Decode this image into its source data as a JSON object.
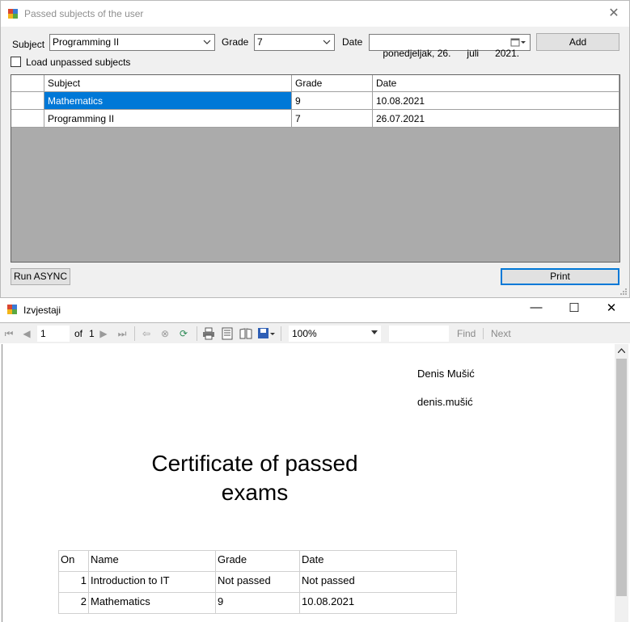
{
  "window1": {
    "title": "Passed subjects of the user",
    "subject_label": "Subject",
    "subject_value": "Programming II",
    "grade_label": "Grade",
    "grade_value": "7",
    "date_label": "Date",
    "date_value": "ponedjeljak, 26.      juli      2021.",
    "add_button": "Add",
    "load_unpassed_label": "Load unpassed subjects",
    "load_unpassed_checked": false,
    "grid": {
      "columns": [
        "Subject",
        "Grade",
        "Date"
      ],
      "rows": [
        {
          "subject": "Mathematics",
          "grade": "9",
          "date": "10.08.2021",
          "selected": true
        },
        {
          "subject": "Programming II",
          "grade": "7",
          "date": "26.07.2021",
          "selected": false
        }
      ]
    },
    "run_async_button": "Run ASYNC",
    "print_button": "Print"
  },
  "window2": {
    "title": "Izvjestaji",
    "toolbar": {
      "page_input": "1",
      "of_label": "of",
      "total_pages": "1",
      "zoom": "100%",
      "find_label": "Find",
      "next_label": "Next"
    },
    "report": {
      "user_name": "Denis Mušić",
      "username": "denis.mušić",
      "title_line1": "Certificate of passed",
      "title_line2": "exams",
      "table": {
        "columns": [
          "On",
          "Name",
          "Grade",
          "Date"
        ],
        "rows": [
          {
            "on": "1",
            "name": "Introduction to IT",
            "grade": "Not passed",
            "date": "Not passed"
          },
          {
            "on": "2",
            "name": "Mathematics",
            "grade": "9",
            "date": "10.08.2021"
          }
        ]
      }
    }
  },
  "colors": {
    "selection": "#0078d7",
    "form_background": "#f0f0f0",
    "grid_background": "#ababab"
  }
}
